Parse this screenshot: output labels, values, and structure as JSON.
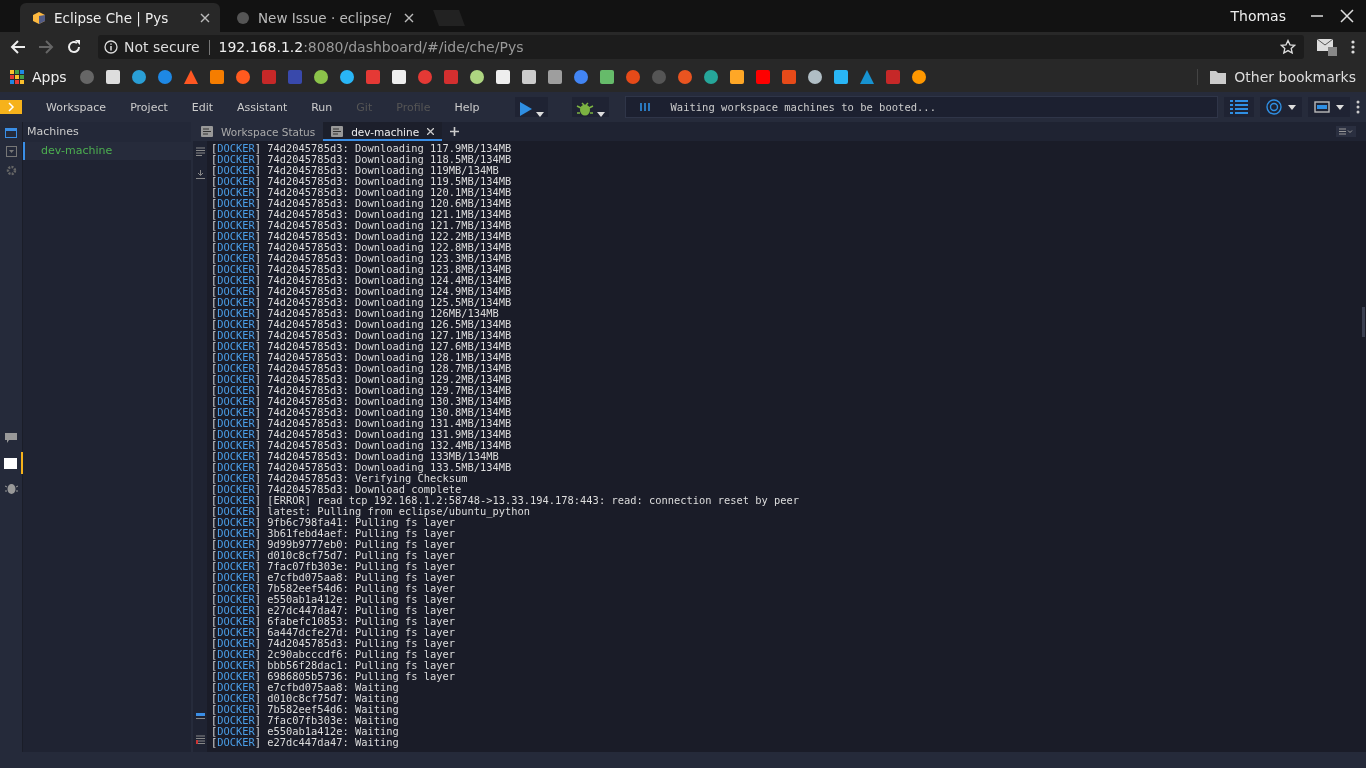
{
  "browser": {
    "tabs": [
      {
        "title": "Eclipse Che | Pys",
        "selected": true
      },
      {
        "title": "New Issue · eclipse/",
        "selected": false
      }
    ],
    "user": "Thomas",
    "address": {
      "security": "Not secure",
      "host": "192.168.1.2",
      "path": ":8080/dashboard/#/ide/che/Pys"
    },
    "bookmarks": {
      "apps": "Apps",
      "other": "Other bookmarks"
    }
  },
  "menu": [
    {
      "label": "Workspace",
      "disabled": false
    },
    {
      "label": "Project",
      "disabled": false
    },
    {
      "label": "Edit",
      "disabled": false
    },
    {
      "label": "Assistant",
      "disabled": false
    },
    {
      "label": "Run",
      "disabled": false
    },
    {
      "label": "Git",
      "disabled": true
    },
    {
      "label": "Profile",
      "disabled": true
    },
    {
      "label": "Help",
      "disabled": false
    }
  ],
  "status": {
    "text": "Waiting workspace machines to be booted..."
  },
  "machines": {
    "title": "Machines",
    "items": [
      {
        "name": "dev-machine",
        "selected": true
      }
    ]
  },
  "editor_tabs": [
    {
      "label": "Workspace Status",
      "selected": false
    },
    {
      "label": "dev-machine",
      "selected": true
    }
  ],
  "log": {
    "open": "[",
    "close": "]",
    "lines": [
      {
        "source": "DOCKER",
        "message": "74d2045785d3: Downloading 117.9MB/134MB"
      },
      {
        "source": "DOCKER",
        "message": "74d2045785d3: Downloading 118.5MB/134MB"
      },
      {
        "source": "DOCKER",
        "message": "74d2045785d3: Downloading 119MB/134MB"
      },
      {
        "source": "DOCKER",
        "message": "74d2045785d3: Downloading 119.5MB/134MB"
      },
      {
        "source": "DOCKER",
        "message": "74d2045785d3: Downloading 120.1MB/134MB"
      },
      {
        "source": "DOCKER",
        "message": "74d2045785d3: Downloading 120.6MB/134MB"
      },
      {
        "source": "DOCKER",
        "message": "74d2045785d3: Downloading 121.1MB/134MB"
      },
      {
        "source": "DOCKER",
        "message": "74d2045785d3: Downloading 121.7MB/134MB"
      },
      {
        "source": "DOCKER",
        "message": "74d2045785d3: Downloading 122.2MB/134MB"
      },
      {
        "source": "DOCKER",
        "message": "74d2045785d3: Downloading 122.8MB/134MB"
      },
      {
        "source": "DOCKER",
        "message": "74d2045785d3: Downloading 123.3MB/134MB"
      },
      {
        "source": "DOCKER",
        "message": "74d2045785d3: Downloading 123.8MB/134MB"
      },
      {
        "source": "DOCKER",
        "message": "74d2045785d3: Downloading 124.4MB/134MB"
      },
      {
        "source": "DOCKER",
        "message": "74d2045785d3: Downloading 124.9MB/134MB"
      },
      {
        "source": "DOCKER",
        "message": "74d2045785d3: Downloading 125.5MB/134MB"
      },
      {
        "source": "DOCKER",
        "message": "74d2045785d3: Downloading 126MB/134MB"
      },
      {
        "source": "DOCKER",
        "message": "74d2045785d3: Downloading 126.5MB/134MB"
      },
      {
        "source": "DOCKER",
        "message": "74d2045785d3: Downloading 127.1MB/134MB"
      },
      {
        "source": "DOCKER",
        "message": "74d2045785d3: Downloading 127.6MB/134MB"
      },
      {
        "source": "DOCKER",
        "message": "74d2045785d3: Downloading 128.1MB/134MB"
      },
      {
        "source": "DOCKER",
        "message": "74d2045785d3: Downloading 128.7MB/134MB"
      },
      {
        "source": "DOCKER",
        "message": "74d2045785d3: Downloading 129.2MB/134MB"
      },
      {
        "source": "DOCKER",
        "message": "74d2045785d3: Downloading 129.7MB/134MB"
      },
      {
        "source": "DOCKER",
        "message": "74d2045785d3: Downloading 130.3MB/134MB"
      },
      {
        "source": "DOCKER",
        "message": "74d2045785d3: Downloading 130.8MB/134MB"
      },
      {
        "source": "DOCKER",
        "message": "74d2045785d3: Downloading 131.4MB/134MB"
      },
      {
        "source": "DOCKER",
        "message": "74d2045785d3: Downloading 131.9MB/134MB"
      },
      {
        "source": "DOCKER",
        "message": "74d2045785d3: Downloading 132.4MB/134MB"
      },
      {
        "source": "DOCKER",
        "message": "74d2045785d3: Downloading 133MB/134MB"
      },
      {
        "source": "DOCKER",
        "message": "74d2045785d3: Downloading 133.5MB/134MB"
      },
      {
        "source": "DOCKER",
        "message": "74d2045785d3: Verifying Checksum"
      },
      {
        "source": "DOCKER",
        "message": "74d2045785d3: Download complete"
      },
      {
        "source": "DOCKER",
        "message": "[ERROR] read tcp 192.168.1.2:58748->13.33.194.178:443: read: connection reset by peer"
      },
      {
        "source": "DOCKER",
        "message": "latest: Pulling from eclipse/ubuntu_python"
      },
      {
        "source": "DOCKER",
        "message": "9fb6c798fa41: Pulling fs layer"
      },
      {
        "source": "DOCKER",
        "message": "3b61febd4aef: Pulling fs layer"
      },
      {
        "source": "DOCKER",
        "message": "9d99b9777eb0: Pulling fs layer"
      },
      {
        "source": "DOCKER",
        "message": "d010c8cf75d7: Pulling fs layer"
      },
      {
        "source": "DOCKER",
        "message": "7fac07fb303e: Pulling fs layer"
      },
      {
        "source": "DOCKER",
        "message": "e7cfbd075aa8: Pulling fs layer"
      },
      {
        "source": "DOCKER",
        "message": "7b582eef54d6: Pulling fs layer"
      },
      {
        "source": "DOCKER",
        "message": "e550ab1a412e: Pulling fs layer"
      },
      {
        "source": "DOCKER",
        "message": "e27dc447da47: Pulling fs layer"
      },
      {
        "source": "DOCKER",
        "message": "6fabefc10853: Pulling fs layer"
      },
      {
        "source": "DOCKER",
        "message": "6a447dcfe27d: Pulling fs layer"
      },
      {
        "source": "DOCKER",
        "message": "74d2045785d3: Pulling fs layer"
      },
      {
        "source": "DOCKER",
        "message": "2c90abcccdf6: Pulling fs layer"
      },
      {
        "source": "DOCKER",
        "message": "bbb56f28dac1: Pulling fs layer"
      },
      {
        "source": "DOCKER",
        "message": "6986805b5736: Pulling fs layer"
      },
      {
        "source": "DOCKER",
        "message": "e7cfbd075aa8: Waiting"
      },
      {
        "source": "DOCKER",
        "message": "d010c8cf75d7: Waiting"
      },
      {
        "source": "DOCKER",
        "message": "7b582eef54d6: Waiting"
      },
      {
        "source": "DOCKER",
        "message": "7fac07fb303e: Waiting"
      },
      {
        "source": "DOCKER",
        "message": "e550ab1a412e: Waiting"
      },
      {
        "source": "DOCKER",
        "message": "e27dc447da47: Waiting"
      }
    ]
  }
}
